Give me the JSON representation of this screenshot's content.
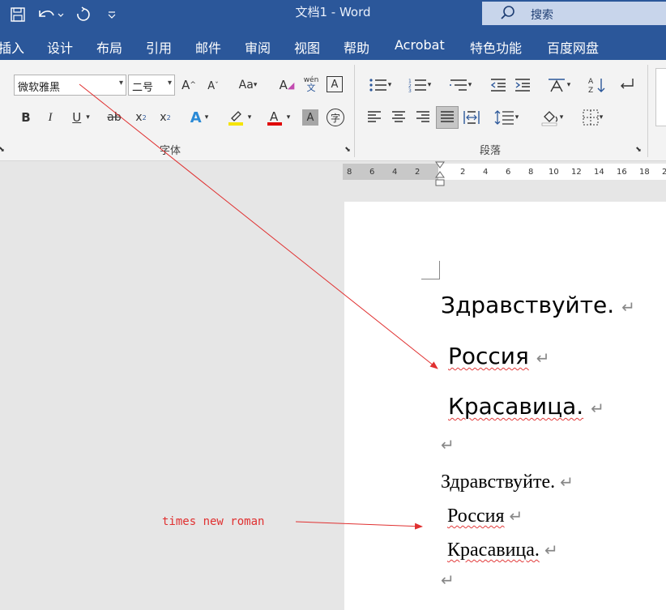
{
  "window": {
    "title": "文档1  -  Word"
  },
  "search": {
    "placeholder": "搜索"
  },
  "tabs": [
    "插入",
    "设计",
    "布局",
    "引用",
    "邮件",
    "审阅",
    "视图",
    "帮助",
    "Acrobat",
    "特色功能",
    "百度网盘"
  ],
  "font": {
    "name": "微软雅黑",
    "size": "二号",
    "group_label": "字体"
  },
  "paragraph": {
    "group_label": "段落"
  },
  "ruler": {
    "left_numbers": [
      "8",
      "6",
      "4",
      "2"
    ],
    "right_numbers": [
      "2",
      "4",
      "6",
      "8",
      "10",
      "12",
      "14",
      "16",
      "18",
      "2"
    ]
  },
  "document": {
    "block1": [
      "Здравствуйте.",
      "Россия",
      "Красавица."
    ],
    "block2": [
      "Здравствуйте.",
      "Россия",
      "Красавица."
    ],
    "paragraph_mark": "↵"
  },
  "annotation": {
    "text": "times new roman",
    "color": "#e03030"
  }
}
